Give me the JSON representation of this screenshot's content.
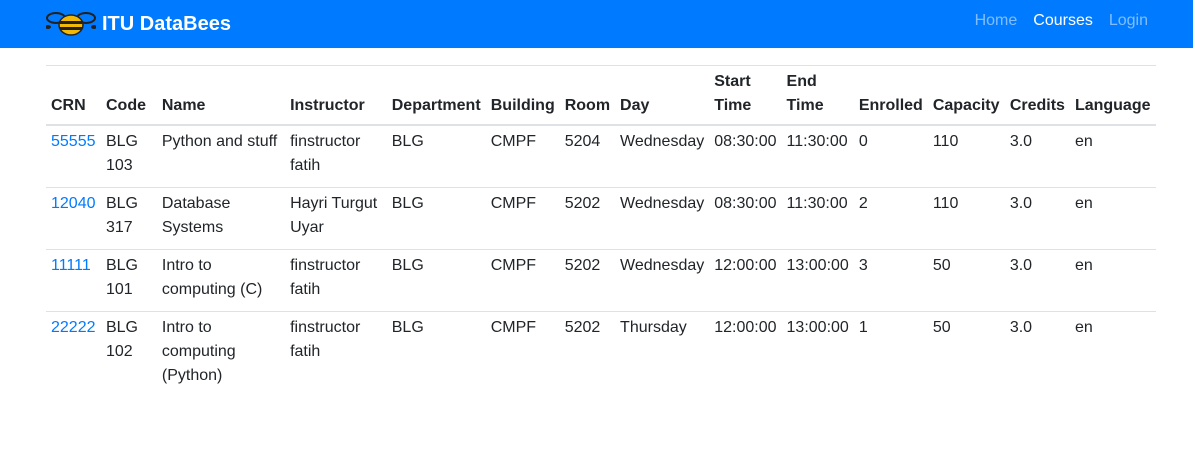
{
  "navbar": {
    "brand": "ITU DataBees",
    "brand_icon": "bee-icon",
    "links": [
      {
        "label": "Home",
        "active": false
      },
      {
        "label": "Courses",
        "active": true
      },
      {
        "label": "Login",
        "active": false
      }
    ],
    "bg_color": "#007bff"
  },
  "table": {
    "headers": [
      "CRN",
      "Code",
      "Name",
      "Instructor",
      "Department",
      "Building",
      "Room",
      "Day",
      "Start Time",
      "End Time",
      "Enrolled",
      "Capacity",
      "Credits",
      "Language"
    ],
    "rows": [
      {
        "crn": "55555",
        "code": "BLG 103",
        "name": "Python and stuff",
        "instructor": "finstructor fatih",
        "department": "BLG",
        "building": "CMPF",
        "room": "5204",
        "day": "Wednesday",
        "start": "08:30:00",
        "end": "11:30:00",
        "enrolled": "0",
        "capacity": "110",
        "credits": "3.0",
        "language": "en"
      },
      {
        "crn": "12040",
        "code": "BLG 317",
        "name": "Database Systems",
        "instructor": "Hayri Turgut Uyar",
        "department": "BLG",
        "building": "CMPF",
        "room": "5202",
        "day": "Wednesday",
        "start": "08:30:00",
        "end": "11:30:00",
        "enrolled": "2",
        "capacity": "110",
        "credits": "3.0",
        "language": "en"
      },
      {
        "crn": "11111",
        "code": "BLG 101",
        "name": "Intro to computing (C)",
        "instructor": "finstructor fatih",
        "department": "BLG",
        "building": "CMPF",
        "room": "5202",
        "day": "Wednesday",
        "start": "12:00:00",
        "end": "13:00:00",
        "enrolled": "3",
        "capacity": "50",
        "credits": "3.0",
        "language": "en"
      },
      {
        "crn": "22222",
        "code": "BLG 102",
        "name": "Intro to computing (Python)",
        "instructor": "finstructor fatih",
        "department": "BLG",
        "building": "CMPF",
        "room": "5202",
        "day": "Thursday",
        "start": "12:00:00",
        "end": "13:00:00",
        "enrolled": "1",
        "capacity": "50",
        "credits": "3.0",
        "language": "en"
      }
    ]
  }
}
